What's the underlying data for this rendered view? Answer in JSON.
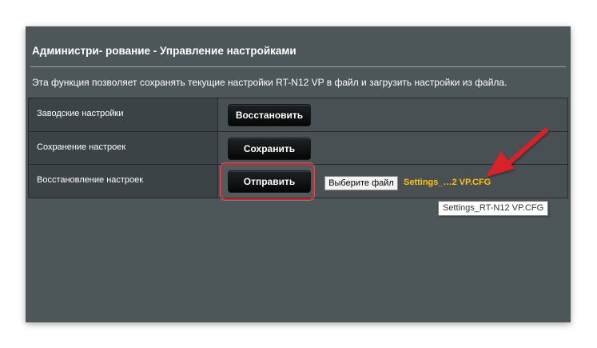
{
  "page": {
    "title": "Администри- рование - Управление настройками",
    "description": "Эта функция позволяет сохранять текущие настройки RT-N12 VP в файл и загрузить настройки из файла."
  },
  "rows": [
    {
      "label": "Заводские настройки",
      "button": "Восстановить"
    },
    {
      "label": "Сохранение настроек",
      "button": "Сохранить"
    },
    {
      "label": "Восстановление настроек",
      "button": "Отправить"
    }
  ],
  "file_input": {
    "button_label": "Выберите файл",
    "selected_file": "Settings_…2 VP.CFG"
  },
  "tooltip": {
    "text": "Settings_RT-N12 VP.CFG"
  },
  "colors": {
    "panel_bg": "#4d5659",
    "file_name": "#ffc10e",
    "annotation_red": "#d8242a"
  },
  "annotations": {
    "arrow_icon": "red-arrow-icon",
    "highlight": "red-rounded-box"
  }
}
